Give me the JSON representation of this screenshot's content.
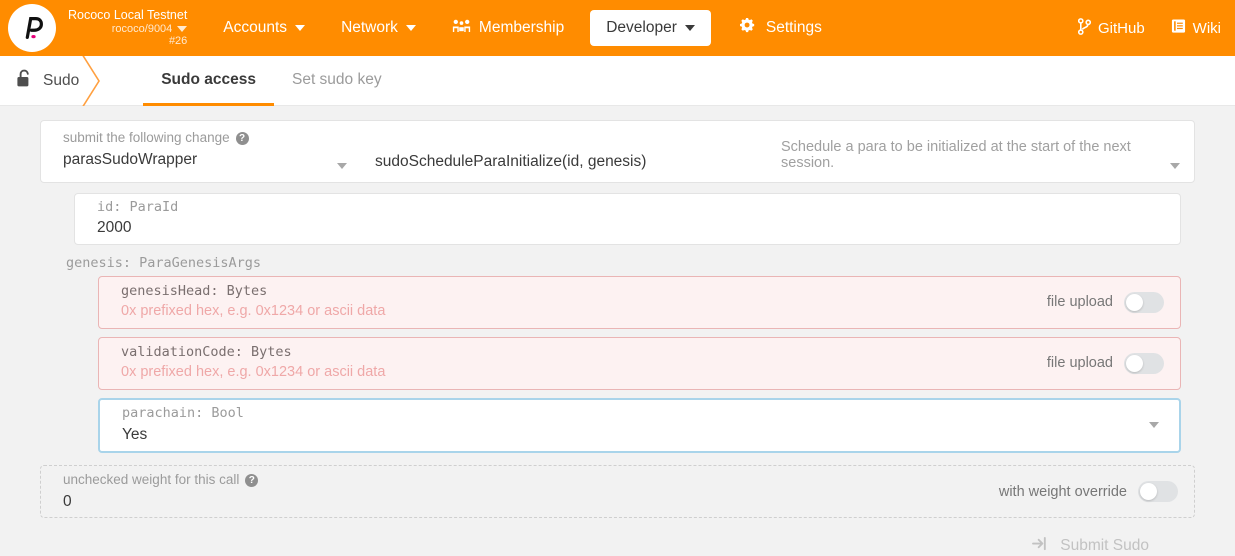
{
  "header": {
    "logo_icon": "polkadot-logo",
    "network": {
      "name": "Rococo Local Testnet",
      "endpoint": "rococo/9004",
      "block": "#26"
    },
    "nav": [
      {
        "label": "Accounts",
        "has_caret": true,
        "active": false
      },
      {
        "label": "Network",
        "has_caret": true,
        "active": false
      },
      {
        "label": "Membership",
        "has_caret": false,
        "active": false,
        "icon": "users-icon"
      },
      {
        "label": "Developer",
        "has_caret": true,
        "active": true
      },
      {
        "label": "Settings",
        "has_caret": false,
        "active": false,
        "icon": "gear-icon"
      }
    ],
    "right_links": [
      {
        "label": "GitHub",
        "icon": "git-branch-icon"
      },
      {
        "label": "Wiki",
        "icon": "book-icon"
      }
    ]
  },
  "breadcrumb": {
    "icon": "unlock-icon",
    "label": "Sudo"
  },
  "tabs": [
    {
      "label": "Sudo access",
      "active": true
    },
    {
      "label": "Set sudo key",
      "active": false
    }
  ],
  "form": {
    "extrinsic": {
      "label": "submit the following change",
      "help_icon": "question-mark-icon",
      "pallet": "parasSudoWrapper",
      "method": "sudoScheduleParaInitialize(id, genesis)",
      "description": "Schedule a para to be initialized at the start of the next session."
    },
    "params": {
      "id": {
        "label": "id: ParaId",
        "value": "2000"
      },
      "genesis_group_label": "genesis: ParaGenesisArgs",
      "genesis_head": {
        "label": "genesisHead: Bytes",
        "placeholder": "0x prefixed hex, e.g. 0x1234 or ascii data",
        "toggle_label": "file upload",
        "toggle_on": false
      },
      "validation_code": {
        "label": "validationCode: Bytes",
        "placeholder": "0x prefixed hex, e.g. 0x1234 or ascii data",
        "toggle_label": "file upload",
        "toggle_on": false
      },
      "parachain": {
        "label": "parachain: Bool",
        "value": "Yes"
      }
    },
    "weight": {
      "label": "unchecked weight for this call",
      "help_icon": "question-mark-icon",
      "value": "0",
      "toggle_label": "with weight override",
      "toggle_on": false
    },
    "submit": {
      "label": "Submit Sudo",
      "icon": "sign-in-icon",
      "disabled": true
    }
  },
  "colors": {
    "brand_orange": "#ff8c00",
    "page_bg": "#f2f2f2",
    "error_bg": "#fdf2f2",
    "error_border": "#eab5b5",
    "error_text": "#efa8a8",
    "focus_border": "#a9d4ea"
  }
}
